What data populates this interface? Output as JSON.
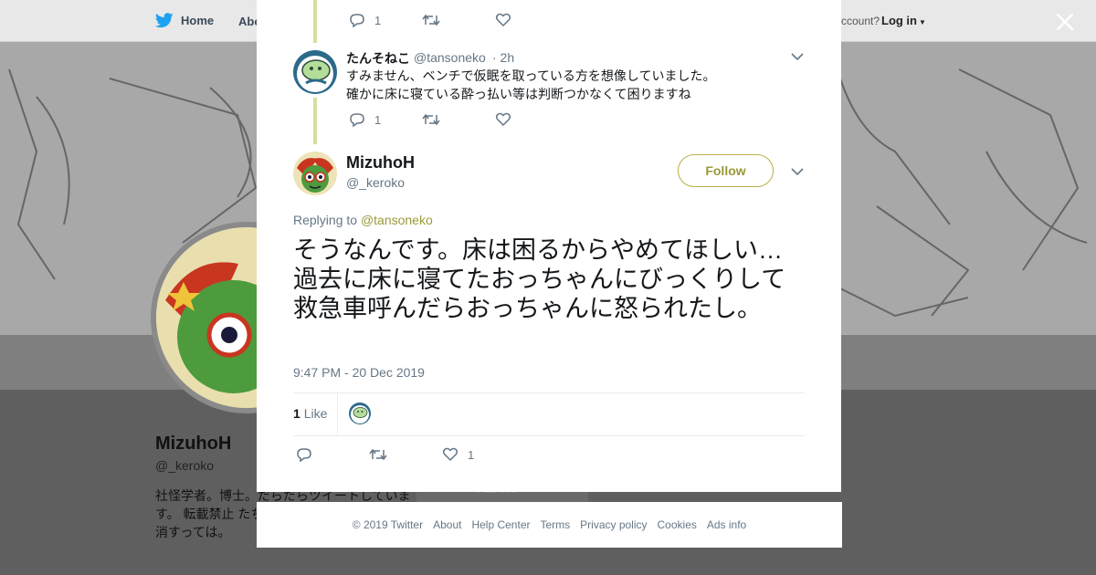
{
  "nav": {
    "home_label": "Home",
    "about_label": "Abo",
    "account_text": "ccount?",
    "login_label": "Log in"
  },
  "profile": {
    "name": "MizuhoH",
    "handle": "@_keroko",
    "bio": "社怪学者。博士。だらだらツイートしています。 転載禁止 たち」(青弓社)ア らツイート消すっては。",
    "card_text": "Ads info"
  },
  "reply": {
    "top_reply_count": "1",
    "name": "たんそねこ",
    "handle": "@tansoneko",
    "time": "· 2h",
    "text_line1": "すみません、ベンチで仮眠を取っている方を想像していました。",
    "text_line2": "確かに床に寝ている酔っ払い等は判断つかなくて困りますね",
    "reply_count": "1"
  },
  "tweet": {
    "name": "MizuhoH",
    "handle": "@_keroko",
    "follow_label": "Follow",
    "replying_prefix": "Replying to ",
    "replying_to": "@tansoneko",
    "text": "そうなんです。床は困るからやめてほしい…過去に床に寝てたおっちゃんにびっくりして救急車呼んだらおっちゃんに怒られたし。",
    "timestamp": "9:47 PM - 20 Dec 2019",
    "likes_number": "1",
    "likes_label": "Like",
    "like_count_action": "1"
  },
  "footer": {
    "copyright": "© 2019 Twitter",
    "about": "About",
    "help": "Help Center",
    "terms": "Terms",
    "privacy": "Privacy policy",
    "cookies": "Cookies",
    "ads": "Ads info"
  },
  "colors": {
    "accent": "#9a9a3a",
    "thread_line": "#d6dea0",
    "muted": "#657786",
    "twitter_blue": "#1da1f2"
  },
  "icons": [
    "twitter-bird-icon",
    "reply-icon",
    "retweet-icon",
    "like-icon",
    "chevron-down-icon",
    "close-icon"
  ]
}
